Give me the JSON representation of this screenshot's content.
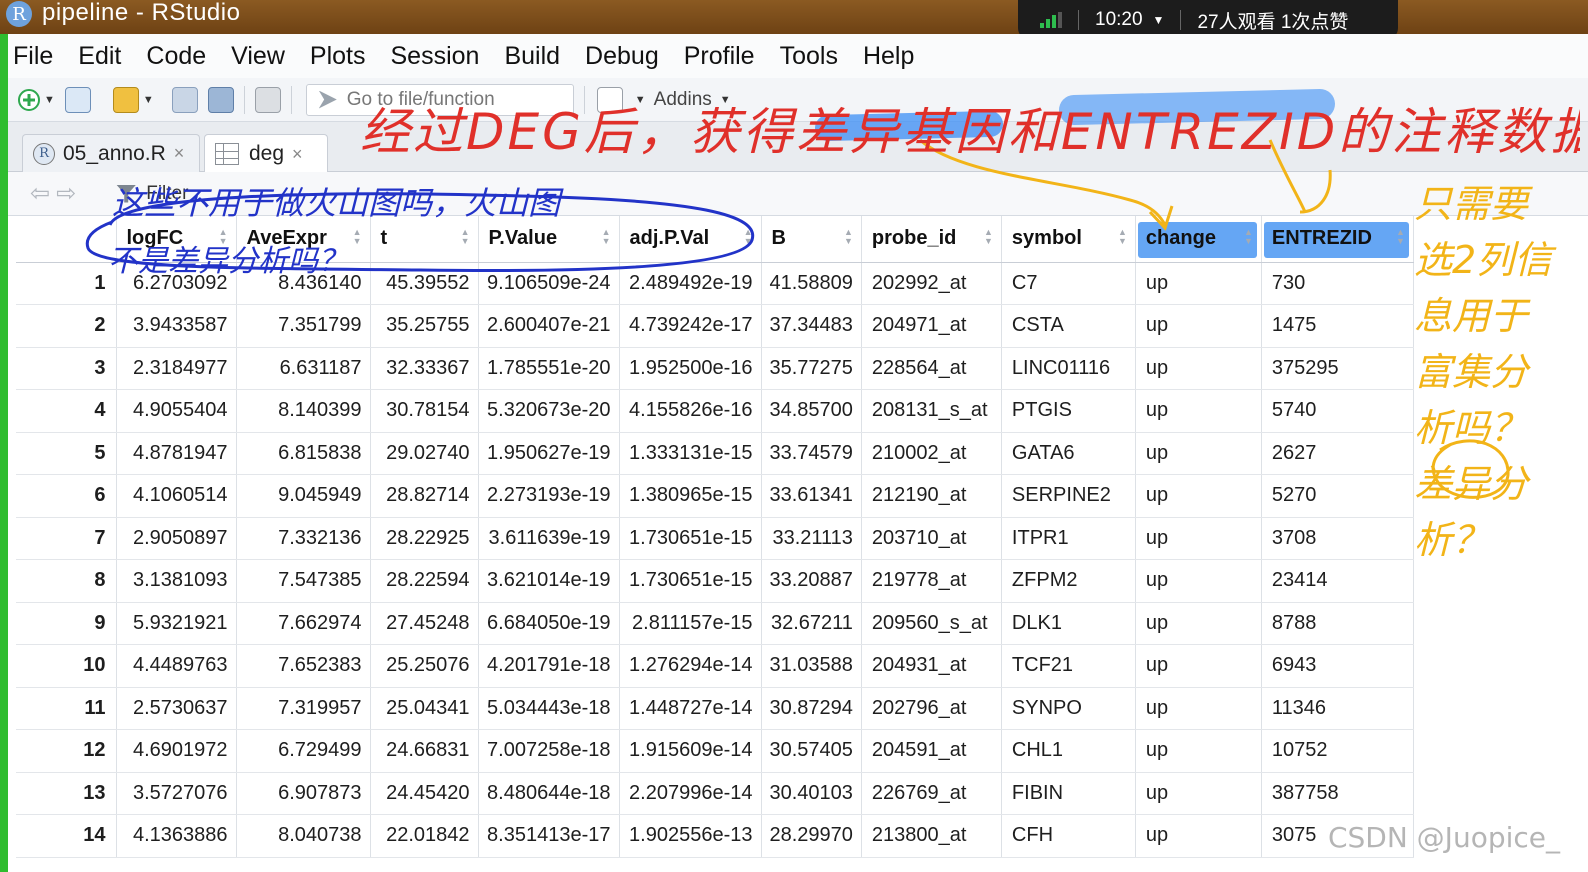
{
  "window": {
    "title": "pipeline - RStudio",
    "logo_letter": "R"
  },
  "overlay": {
    "time": "10:20",
    "stats": "27人观看  1次点赞"
  },
  "menu": [
    "File",
    "Edit",
    "Code",
    "View",
    "Plots",
    "Session",
    "Build",
    "Debug",
    "Profile",
    "Tools",
    "Help"
  ],
  "toolbar": {
    "goto_placeholder": "Go to file/function",
    "addins_label": "Addins"
  },
  "tabs": [
    {
      "label": "05_anno.R",
      "close": "×"
    },
    {
      "label": "deg",
      "close": "×"
    }
  ],
  "viewer": {
    "filter_label": "Filter"
  },
  "table": {
    "columns": [
      "",
      "logFC",
      "AveExpr",
      "t",
      "P.Value",
      "adj.P.Val",
      "B",
      "probe_id",
      "symbol",
      "change",
      "ENTREZID"
    ],
    "rows": [
      [
        "1",
        "6.2703092",
        "8.436140",
        "45.39552",
        "9.106509e-24",
        "2.489492e-19",
        "41.58809",
        "202992_at",
        "C7",
        "up",
        "730"
      ],
      [
        "2",
        "3.9433587",
        "7.351799",
        "35.25755",
        "2.600407e-21",
        "4.739242e-17",
        "37.34483",
        "204971_at",
        "CSTA",
        "up",
        "1475"
      ],
      [
        "3",
        "2.3184977",
        "6.631187",
        "32.33367",
        "1.785551e-20",
        "1.952500e-16",
        "35.77275",
        "228564_at",
        "LINC01116",
        "up",
        "375295"
      ],
      [
        "4",
        "4.9055404",
        "8.140399",
        "30.78154",
        "5.320673e-20",
        "4.155826e-16",
        "34.85700",
        "208131_s_at",
        "PTGIS",
        "up",
        "5740"
      ],
      [
        "5",
        "4.8781947",
        "6.815838",
        "29.02740",
        "1.950627e-19",
        "1.333131e-15",
        "33.74579",
        "210002_at",
        "GATA6",
        "up",
        "2627"
      ],
      [
        "6",
        "4.1060514",
        "9.045949",
        "28.82714",
        "2.273193e-19",
        "1.380965e-15",
        "33.61341",
        "212190_at",
        "SERPINE2",
        "up",
        "5270"
      ],
      [
        "7",
        "2.9050897",
        "7.332136",
        "28.22925",
        "3.611639e-19",
        "1.730651e-15",
        "33.21113",
        "203710_at",
        "ITPR1",
        "up",
        "3708"
      ],
      [
        "8",
        "3.1381093",
        "7.547385",
        "28.22594",
        "3.621014e-19",
        "1.730651e-15",
        "33.20887",
        "219778_at",
        "ZFPM2",
        "up",
        "23414"
      ],
      [
        "9",
        "5.9321921",
        "7.662974",
        "27.45248",
        "6.684050e-19",
        "2.811157e-15",
        "32.67211",
        "209560_s_at",
        "DLK1",
        "up",
        "8788"
      ],
      [
        "10",
        "4.4489763",
        "7.652383",
        "25.25076",
        "4.201791e-18",
        "1.276294e-14",
        "31.03588",
        "204931_at",
        "TCF21",
        "up",
        "6943"
      ],
      [
        "11",
        "2.5730637",
        "7.319957",
        "25.04341",
        "5.034443e-18",
        "1.448727e-14",
        "30.87294",
        "202796_at",
        "SYNPO",
        "up",
        "11346"
      ],
      [
        "12",
        "4.6901972",
        "6.729499",
        "24.66831",
        "7.007258e-18",
        "1.915609e-14",
        "30.57405",
        "204591_at",
        "CHL1",
        "up",
        "10752"
      ],
      [
        "13",
        "3.5727076",
        "6.907873",
        "24.45420",
        "8.480644e-18",
        "2.207996e-14",
        "30.40103",
        "226769_at",
        "FIBIN",
        "up",
        "387758"
      ],
      [
        "14",
        "4.1363886",
        "8.040738",
        "22.01842",
        "8.351413e-17",
        "1.902556e-13",
        "28.29970",
        "213800_at",
        "CFH",
        "up",
        "3075"
      ]
    ]
  },
  "annotations": {
    "top_note": "经过DEG后，获得差异基因和ENTREZID的注释数据",
    "left_note_line1": "这些不用于做火山图吗，火山图",
    "left_note_line2": "不是差异分析吗？",
    "right_note": "只需要选2列信息用于富集分析吗？差异分析？",
    "colors": {
      "red": "#e0302a",
      "blue": "#2233c8",
      "orange": "#f2b418",
      "highlight": "#3b8ef5"
    }
  },
  "watermark": "CSDN @Juopice_"
}
